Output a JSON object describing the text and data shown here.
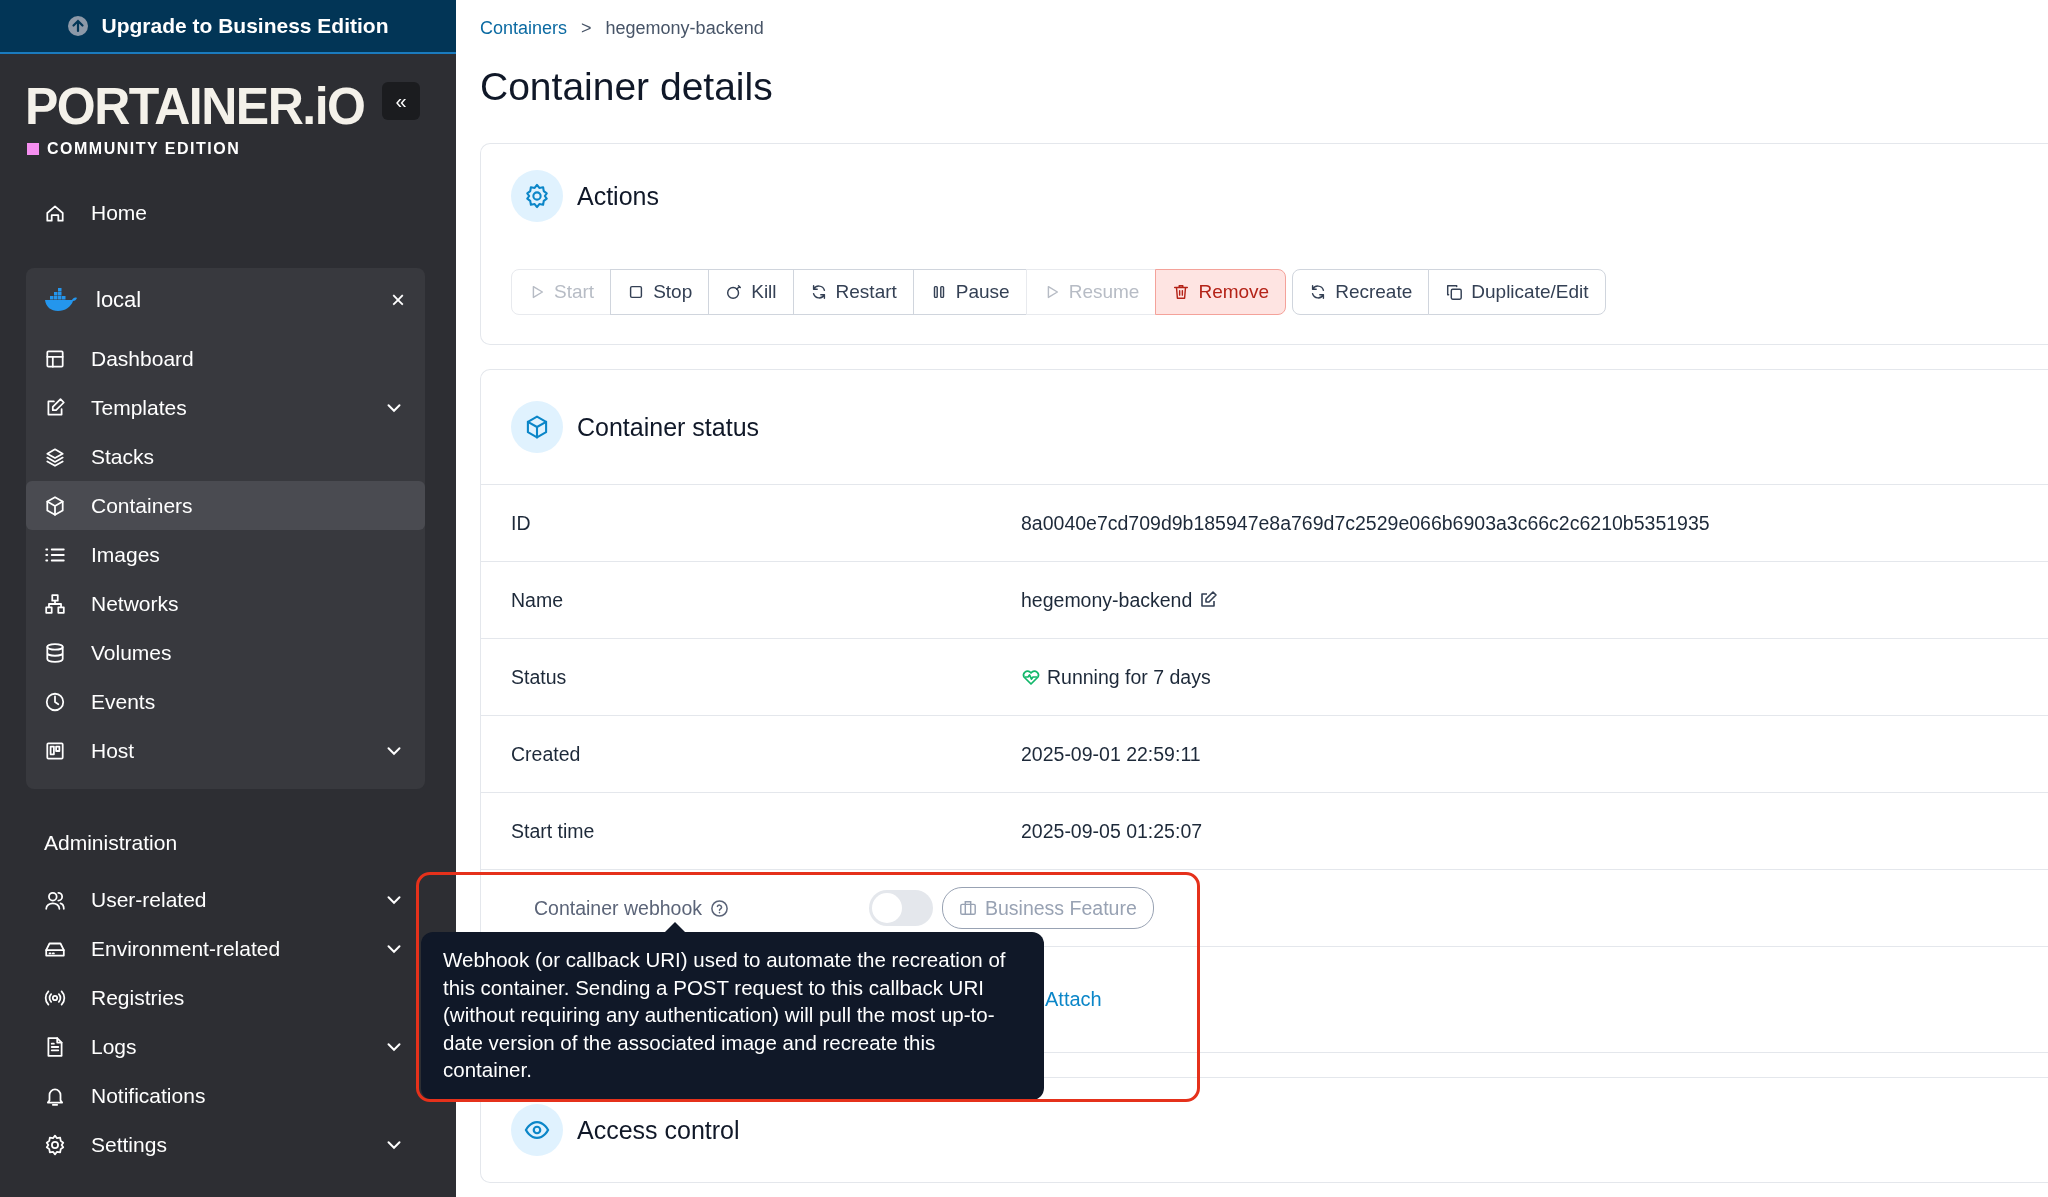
{
  "sidebar": {
    "upgrade": "Upgrade to Business Edition",
    "logo": "PORTAINER.iO",
    "edition": "COMMUNITY EDITION",
    "collapse": "«",
    "home": {
      "label": "Home",
      "kind": "home"
    },
    "environment": {
      "name": "local",
      "close": "×",
      "items": [
        {
          "label": "Dashboard",
          "kind": "dashboard",
          "expandable": false,
          "selected": false
        },
        {
          "label": "Templates",
          "kind": "templates",
          "expandable": true,
          "selected": false
        },
        {
          "label": "Stacks",
          "kind": "stacks",
          "expandable": false,
          "selected": false
        },
        {
          "label": "Containers",
          "kind": "containers",
          "expandable": false,
          "selected": true
        },
        {
          "label": "Images",
          "kind": "images",
          "expandable": false,
          "selected": false
        },
        {
          "label": "Networks",
          "kind": "networks",
          "expandable": false,
          "selected": false
        },
        {
          "label": "Volumes",
          "kind": "volumes",
          "expandable": false,
          "selected": false
        },
        {
          "label": "Events",
          "kind": "events",
          "expandable": false,
          "selected": false
        },
        {
          "label": "Host",
          "kind": "host",
          "expandable": true,
          "selected": false
        }
      ]
    },
    "admin_title": "Administration",
    "admin_items": [
      {
        "label": "User-related",
        "kind": "users",
        "expandable": true,
        "selected": false
      },
      {
        "label": "Environment-related",
        "kind": "drive",
        "expandable": true,
        "selected": false
      },
      {
        "label": "Registries",
        "kind": "registries",
        "expandable": false,
        "selected": false
      },
      {
        "label": "Logs",
        "kind": "logs",
        "expandable": true,
        "selected": false
      },
      {
        "label": "Notifications",
        "kind": "bell",
        "expandable": false,
        "selected": false
      },
      {
        "label": "Settings",
        "kind": "settings",
        "expandable": true,
        "selected": false
      }
    ]
  },
  "breadcrumb": {
    "link": "Containers",
    "separator": ">",
    "current": "hegemony-backend"
  },
  "title": "Container details",
  "actions": {
    "title": "Actions",
    "groups": [
      [
        {
          "label": "Start",
          "kind": "start",
          "disabled": true,
          "danger": false
        },
        {
          "label": "Stop",
          "kind": "stop",
          "disabled": false,
          "danger": false
        },
        {
          "label": "Kill",
          "kind": "kill",
          "disabled": false,
          "danger": false
        },
        {
          "label": "Restart",
          "kind": "restart",
          "disabled": false,
          "danger": false
        },
        {
          "label": "Pause",
          "kind": "pause",
          "disabled": false,
          "danger": false
        },
        {
          "label": "Resume",
          "kind": "start",
          "disabled": true,
          "danger": false
        },
        {
          "label": "Remove",
          "kind": "remove",
          "disabled": false,
          "danger": true
        }
      ],
      [
        {
          "label": "Recreate",
          "kind": "restart",
          "disabled": false,
          "danger": false
        },
        {
          "label": "Duplicate/Edit",
          "kind": "duplicate",
          "disabled": false,
          "danger": false
        }
      ]
    ]
  },
  "status": {
    "title": "Container status",
    "rows": [
      {
        "label": "ID",
        "value": "8a0040e7cd709d9b185947e8a769d7c2529e066b6903a3c66c2c6210b5351935",
        "kind": "text"
      },
      {
        "label": "Name",
        "value": "hegemony-backend",
        "kind": "editable"
      },
      {
        "label": "Status",
        "value": "Running for 7 days",
        "kind": "health"
      },
      {
        "label": "Created",
        "value": "2025-09-01 22:59:11",
        "kind": "text"
      },
      {
        "label": "Start time",
        "value": "2025-09-05 01:25:07",
        "kind": "text"
      }
    ],
    "webhook": {
      "label": "Container webhook",
      "on": false,
      "badge": "Business Feature",
      "link": "Attach",
      "tooltip": "Webhook (or callback URI) used to automate the recreation of this container. Sending a POST request to this callback URI (without requiring any authentication) will pull the most up-to-date version of the associated image and recreate this container."
    }
  },
  "access": {
    "title": "Access control"
  },
  "annotation": {
    "kind": "frame"
  }
}
